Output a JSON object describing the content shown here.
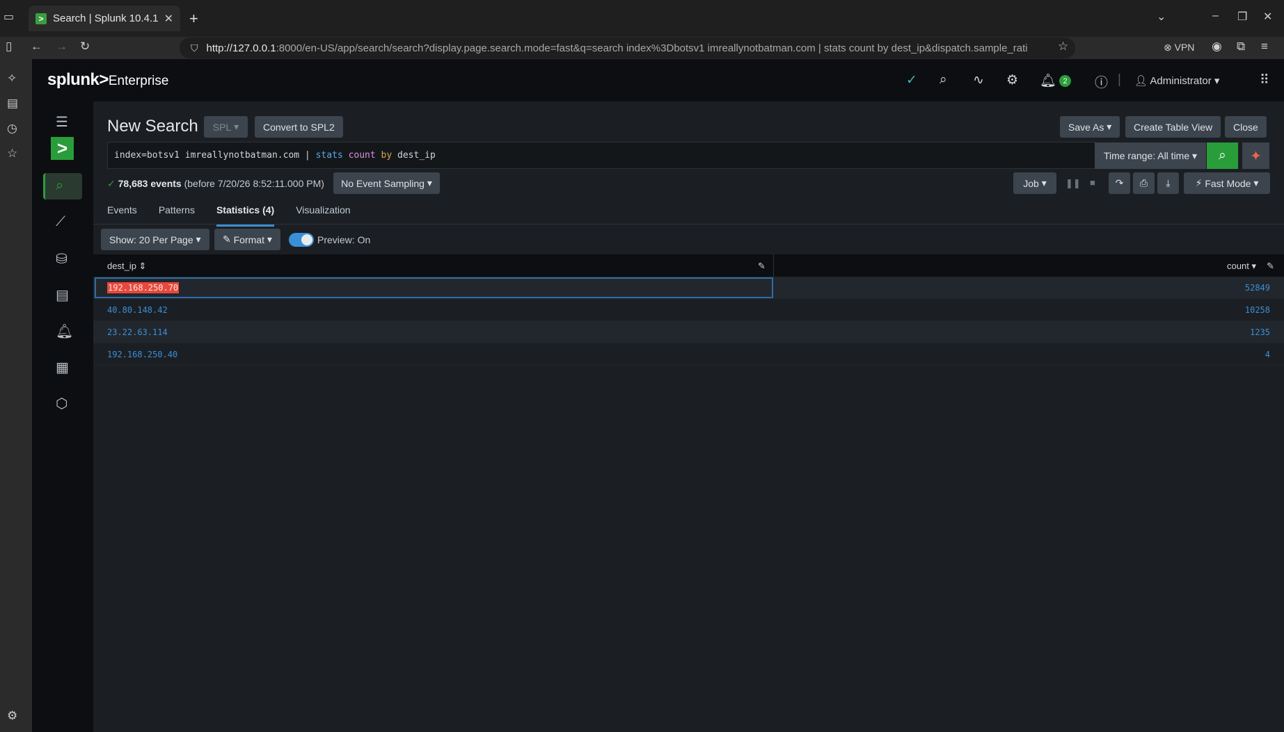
{
  "browser": {
    "tab_title": "Search | Splunk 10.4.1",
    "tab_favicon": ">",
    "url_host": "http://127.0.0.1",
    "url_rest": ":8000/en-US/app/search/search?display.page.search.mode=fast&q=search index%3Dbotsv1 imreallynotbatman.com | stats count by dest_ip&dispatch.sample_rati",
    "vpn_label": "VPN"
  },
  "header": {
    "logo_splunk": "splunk>",
    "logo_product": "Enterprise",
    "notifications_count": "2",
    "user_label": "Administrator"
  },
  "search": {
    "page_title": "New Search",
    "language_label": "SPL",
    "convert_label": "Convert to SPL2",
    "save_as_label": "Save As",
    "create_table_label": "Create Table View",
    "close_label": "Close",
    "query_part1": "index=botsv1 imreallynotbatman.com | ",
    "query_cmd": "stats",
    "query_fn": "count",
    "query_by": "by",
    "query_field": "dest_ip",
    "time_range_label": "Time range: All time",
    "event_count": "78,683 events",
    "event_time": "(before 7/20/26 8:52:11.000 PM)",
    "sampling_label": "No Event Sampling",
    "job_label": "Job",
    "mode_label": "Fast Mode"
  },
  "tabs": [
    {
      "label": "Events"
    },
    {
      "label": "Patterns"
    },
    {
      "label": "Statistics (4)"
    },
    {
      "label": "Visualization"
    }
  ],
  "toolbar": {
    "per_page_label": "Show: 20 Per Page",
    "format_label": "Format",
    "preview_label": "Preview: On"
  },
  "table": {
    "columns": [
      "dest_ip",
      "count"
    ],
    "rows": [
      {
        "dest_ip": "192.168.250.70",
        "count": "52849"
      },
      {
        "dest_ip": "40.80.148.42",
        "count": "10258"
      },
      {
        "dest_ip": "23.22.63.114",
        "count": "1235"
      },
      {
        "dest_ip": "192.168.250.40",
        "count": "4"
      }
    ]
  },
  "colors": {
    "accent_green": "#2a9d3b",
    "link_blue": "#3b8fd6",
    "highlight_red": "#e8483c"
  }
}
